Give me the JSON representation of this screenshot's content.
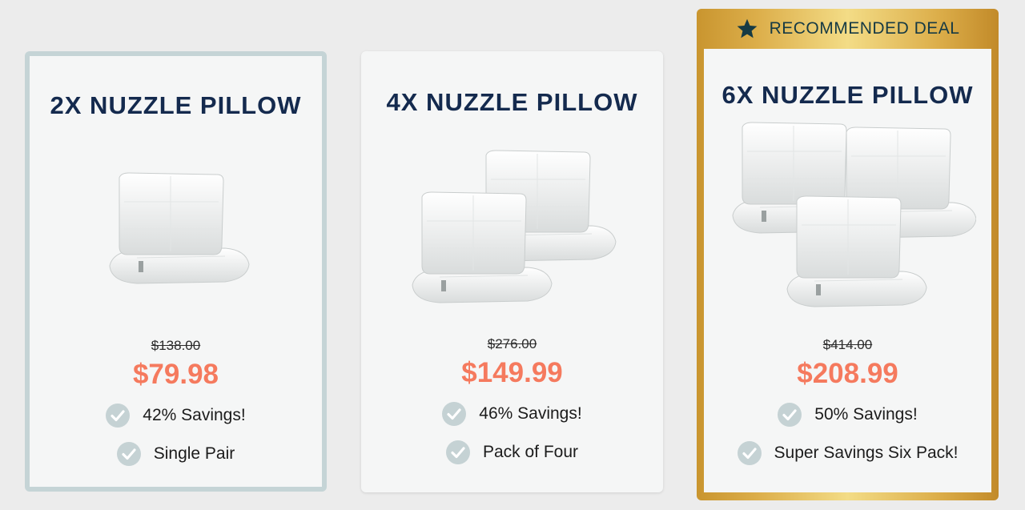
{
  "colors": {
    "title": "#142a4e",
    "price": "#f57a5e",
    "check": "#c5d2d4",
    "gold_border": "#d9a642",
    "selected_border": "#c5d4d6",
    "badge_star": "#163a44"
  },
  "badge": {
    "label": "RECOMMENDED DEAL",
    "icon": "star-icon"
  },
  "cards": [
    {
      "title": "2X NUZZLE PILLOW",
      "old_price": "$138.00",
      "price": "$79.98",
      "features": [
        {
          "icon": "check-icon",
          "label": "42% Savings!"
        },
        {
          "icon": "check-icon",
          "label": "Single Pair"
        }
      ],
      "pillow_count": 2
    },
    {
      "title": "4X NUZZLE PILLOW",
      "old_price": "$276.00",
      "price": "$149.99",
      "features": [
        {
          "icon": "check-icon",
          "label": "46% Savings!"
        },
        {
          "icon": "check-icon",
          "label": "Pack of Four"
        }
      ],
      "pillow_count": 4
    },
    {
      "title": "6X NUZZLE PILLOW",
      "old_price": "$414.00",
      "price": "$208.99",
      "features": [
        {
          "icon": "check-icon",
          "label": "50% Savings!"
        },
        {
          "icon": "check-icon",
          "label": "Super Savings Six Pack!"
        }
      ],
      "pillow_count": 6
    }
  ]
}
